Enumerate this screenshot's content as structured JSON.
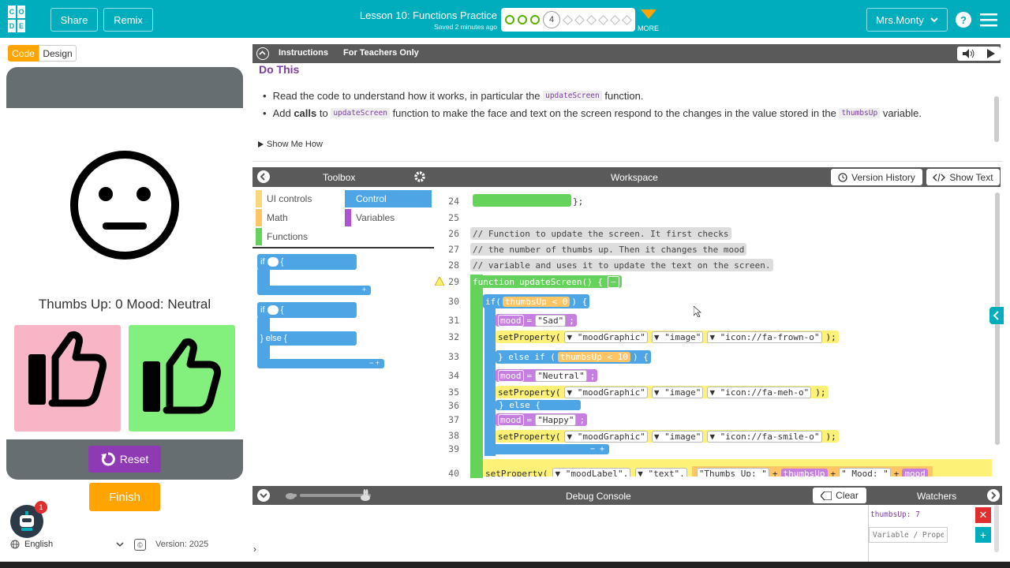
{
  "header": {
    "share_label": "Share",
    "remix_label": "Remix",
    "lesson_title": "Lesson 10: Functions Practice",
    "saved_text": "Saved 2 minutes ago",
    "current_level": "4",
    "more_label": "MORE",
    "user_name": "Mrs.Monty",
    "logo_letters": [
      "C",
      "O",
      "D",
      "E"
    ]
  },
  "sidebar": {
    "tab_code": "Code",
    "tab_design": "Design",
    "app_label": "Thumbs Up: 0 Mood: Neutral",
    "reset_label": "Reset",
    "finish_label": "Finish",
    "notification_count": "1",
    "language": "English",
    "version": "Version: 2025"
  },
  "instructions": {
    "tab_instructions": "Instructions",
    "tab_teachers": "For Teachers Only",
    "heading": "Do This",
    "b1_pre": "Read the code to understand how it works, in particular the ",
    "b1_code": "updateScreen",
    "b1_post": " function.",
    "b2_pre": "Add ",
    "b2_bold": "calls",
    "b2_mid": " to ",
    "b2_code": "updateScreen",
    "b2_mid2": " function to make the face and text on the screen respond to the changes in the value stored in the ",
    "b2_code2": "thumbsUp",
    "b2_post": " variable.",
    "show_me_how": "Show Me How"
  },
  "toolbox": {
    "title": "Toolbox",
    "categories": {
      "ui": "UI controls",
      "control": "Control",
      "math": "Math",
      "variables": "Variables",
      "functions": "Functions"
    },
    "blocks": {
      "if_kw": "if",
      "brace": "{",
      "else_kw": "} else {",
      "plus": "+",
      "minus_plus": "− +"
    }
  },
  "workspace": {
    "title": "Workspace",
    "version_history": "Version History",
    "show_text": "Show Text",
    "line_numbers": [
      "24",
      "25",
      "26",
      "27",
      "28",
      "29",
      "30",
      "31",
      "32",
      "33",
      "34",
      "35",
      "36",
      "37",
      "38",
      "39",
      "40"
    ],
    "code": {
      "l24": "};",
      "l26": "// Function to update the screen. It first checks",
      "l27": "// the number of thumbs up. Then it changes the mood",
      "l28": "// variable and uses it to update the text on the screen.",
      "l29_kw": "function",
      "l29_name": "updateScreen() {",
      "l29_btn": "−",
      "l30_if": "if(",
      "l30_cond": "thumbsUp < 0",
      "l30_close": ") {",
      "l31_var": "mood",
      "l31_eq": "=",
      "l31_val": "\"Sad\"",
      "l31_end": ";",
      "l32_fn": "setProperty(",
      "l32_a1": "▼ \"moodGraphic\"",
      "l32_a2": "▼ \"image\"",
      "l32_a3": "▼ \"icon://fa-frown-o\"",
      "l32_end": ");",
      "l33_else": "} else if (",
      "l33_cond": "thumbsUp < 10",
      "l33_close": ") {",
      "l34_var": "mood",
      "l34_eq": "=",
      "l34_val": "\"Neutral\"",
      "l34_end": ";",
      "l35_fn": "setProperty(",
      "l35_a1": "▼ \"moodGraphic\"",
      "l35_a2": "▼ \"image\"",
      "l35_a3": "▼ \"icon://fa-meh-o\"",
      "l35_end": ");",
      "l36_else": "} else {",
      "l37_var": "mood",
      "l37_eq": "=",
      "l37_val": "\"Happy\"",
      "l37_end": ";",
      "l38_fn": "setProperty(",
      "l38_a1": "▼ \"moodGraphic\"",
      "l38_a2": "▼ \"image\"",
      "l38_a3": "▼ \"icon://fa-smile-o\"",
      "l38_end": ");",
      "l39_btns": "− +",
      "l40_fn": "setProperty(",
      "l40_a1": "▼ \"moodLabel\",",
      "l40_a2": "▼ \"text\",",
      "l40_s1": "\"Thumbs Up: \"",
      "l40_p1": "+",
      "l40_v1": "thumbsUp",
      "l40_p2": "+",
      "l40_s2": "\" Mood: \"",
      "l40_p3": "+",
      "l40_v2": "mood"
    }
  },
  "debug": {
    "title": "Debug Console",
    "clear_label": "Clear",
    "watchers_title": "Watchers",
    "watch_value": "thumbsUp: 7",
    "watch_placeholder": "Variable / Property",
    "prompt": "›"
  },
  "colors": {
    "header": "#00adbc",
    "accent_orange": "#ffa400",
    "reset_purple": "#8e3bb3",
    "thumbs_down_bg": "#f7b5c6",
    "thumbs_up_bg": "#83f07e",
    "control_blue": "#4ea5e6",
    "functions_green": "#65d35b"
  }
}
